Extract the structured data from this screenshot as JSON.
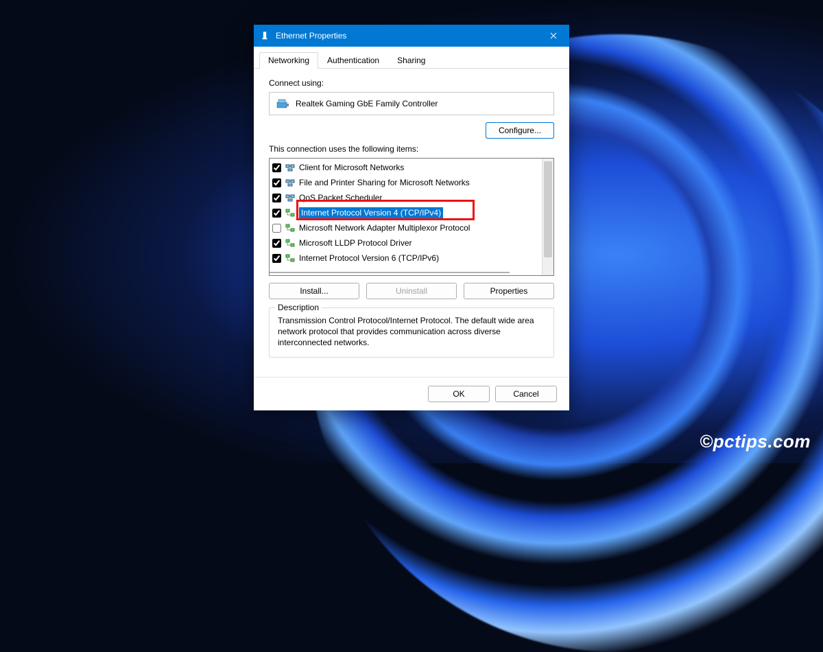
{
  "window": {
    "title": "Ethernet Properties"
  },
  "tabs": {
    "networking": "Networking",
    "authentication": "Authentication",
    "sharing": "Sharing"
  },
  "connect_using_label": "Connect using:",
  "adapter_name": "Realtek Gaming GbE Family Controller",
  "configure_button": "Configure...",
  "items_label": "This connection uses the following items:",
  "items": [
    {
      "checked": true,
      "label": "Client for Microsoft Networks"
    },
    {
      "checked": true,
      "label": "File and Printer Sharing for Microsoft Networks"
    },
    {
      "checked": true,
      "label": "QoS Packet Scheduler"
    },
    {
      "checked": true,
      "label": "Internet Protocol Version 4 (TCP/IPv4)",
      "selected": true
    },
    {
      "checked": false,
      "label": "Microsoft Network Adapter Multiplexor Protocol"
    },
    {
      "checked": true,
      "label": "Microsoft LLDP Protocol Driver"
    },
    {
      "checked": true,
      "label": "Internet Protocol Version 6 (TCP/IPv6)"
    }
  ],
  "buttons": {
    "install": "Install...",
    "uninstall": "Uninstall",
    "properties": "Properties",
    "ok": "OK",
    "cancel": "Cancel"
  },
  "description": {
    "legend": "Description",
    "text": "Transmission Control Protocol/Internet Protocol. The default wide area network protocol that provides communication across diverse interconnected networks."
  },
  "watermark": "©pctips.com"
}
